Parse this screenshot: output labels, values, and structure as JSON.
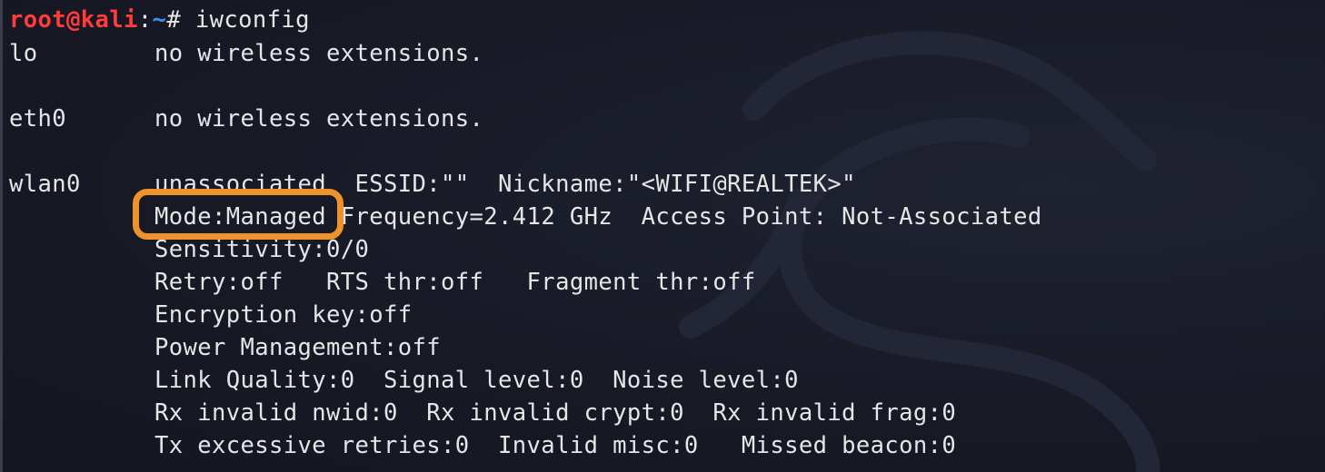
{
  "prompt": {
    "user_host": "root@kali",
    "colon": ":",
    "path": "~",
    "symbol": "# ",
    "command": "iwconfig"
  },
  "output": {
    "lo": {
      "name": "lo",
      "text": "no wireless extensions."
    },
    "eth0": {
      "name": "eth0",
      "text": "no wireless extensions."
    },
    "wlan0": {
      "name": "wlan0",
      "line1": "unassociated  ESSID:\"\"  Nickname:\"<WIFI@REALTEK>\"",
      "mode": "Mode:Managed",
      "line2_rest": " Frequency=2.412 GHz  Access Point: Not-Associated",
      "line3": "Sensitivity:0/0",
      "line4": "Retry:off   RTS thr:off   Fragment thr:off",
      "line5": "Encryption key:off",
      "line6": "Power Management:off",
      "line7": "Link Quality:0  Signal level:0  Noise level:0",
      "line8": "Rx invalid nwid:0  Rx invalid crypt:0  Rx invalid frag:0",
      "line9": "Tx excessive retries:0  Invalid misc:0   Missed beacon:0"
    }
  },
  "colors": {
    "background": "#181a25",
    "text": "#e6e6e6",
    "user_host": "#ff3b3b",
    "path": "#3b8eea",
    "highlight": "#f0922b"
  },
  "icons": {
    "watermark": "kali-dragon-icon"
  }
}
